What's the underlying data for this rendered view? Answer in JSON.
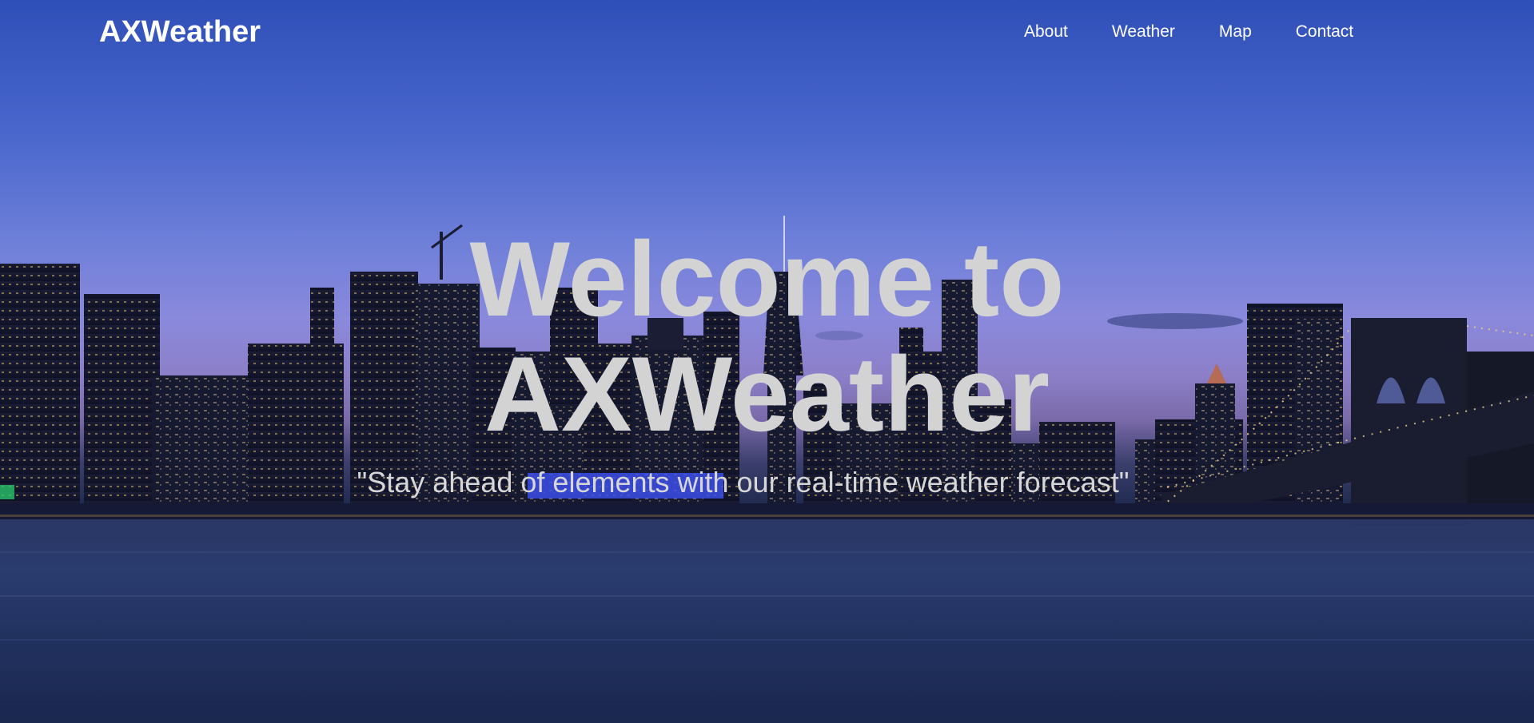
{
  "site": {
    "brand": "AXWeather"
  },
  "nav": {
    "items": [
      {
        "label": "About"
      },
      {
        "label": "Weather"
      },
      {
        "label": "Map"
      },
      {
        "label": "Contact"
      }
    ]
  },
  "hero": {
    "headline_line1": "Welcome to",
    "headline_line2": "AXWeather",
    "tagline": "\"Stay ahead of elements with our real-time weather forecast\""
  },
  "colors": {
    "headline": "#d3d3d3",
    "nav_text": "#ffffff",
    "sky_top": "#2f4fb8",
    "sky_horizon": "#8a89dc",
    "water": "#1c2d5a"
  }
}
